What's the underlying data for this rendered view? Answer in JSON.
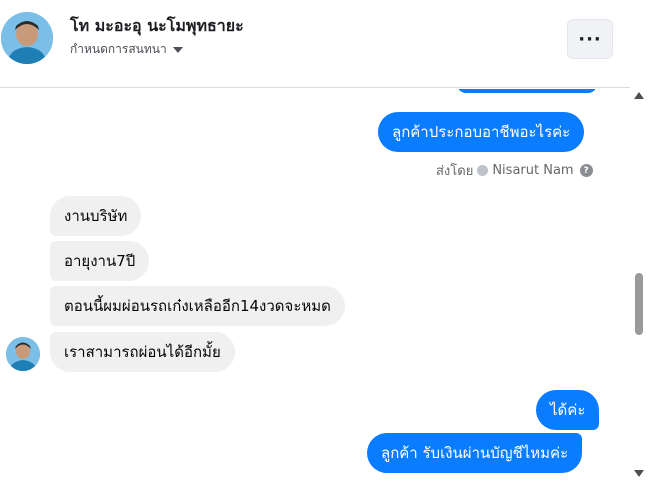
{
  "header": {
    "contact_name": "โท มะอะอุ นะโมพุทธายะ",
    "customize_label": "กำหนดการสนทนา",
    "more_label": "···"
  },
  "messages": {
    "outgoing_1": "ลูกค้าประกอบอาชีพอะไรค่ะ",
    "sent_by_prefix": "ส่งโดย",
    "sent_by_name": "Nisarut Nam",
    "help_glyph": "?",
    "incoming_1": "งานบริษัท",
    "incoming_2": "อายุงาน7ปี",
    "incoming_3": "ตอนนี้ผมผ่อนรถเก๋งเหลืออีก14งวดจะหมด",
    "incoming_4": "เราสามารถผ่อนได้อีกมั้ย",
    "outgoing_2": "ได้ค่ะ",
    "outgoing_3": "ลูกค้า รับเงินผ่านบัญชีไหมค่ะ"
  },
  "colors": {
    "outgoing_bubble": "#0a7cff",
    "incoming_bubble": "#f0f0f0",
    "header_border": "#dadde1"
  },
  "icons": {
    "more": "more-horizontal-icon",
    "caret": "caret-down-icon",
    "seen": "check-circle-icon",
    "help": "help-icon"
  }
}
